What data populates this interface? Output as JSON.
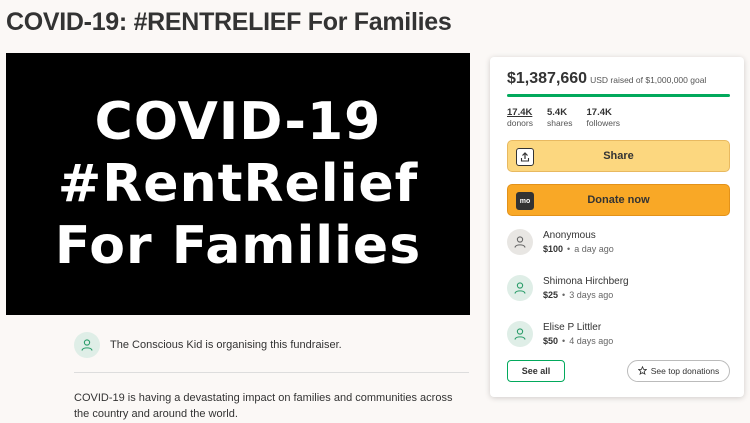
{
  "page": {
    "title": "COVID-19: #RENTRELIEF For Families"
  },
  "hero": {
    "line1": "COVID-19",
    "line2": "#RentRelief",
    "line3": "For Families"
  },
  "organiser": {
    "text": "The Conscious Kid is organising this fundraiser."
  },
  "story": {
    "text": "COVID-19 is having a devastating impact on families and communities across the country and around the world."
  },
  "sidebar": {
    "amount_raised": "$1,387,660",
    "goal_text": "USD raised of $1,000,000 goal",
    "progress_fraction": 1.0,
    "progress_color": "#02a95c",
    "stats": [
      {
        "value": "17.4K",
        "label": "donors"
      },
      {
        "value": "5.4K",
        "label": "shares"
      },
      {
        "value": "17.4K",
        "label": "followers"
      }
    ],
    "share_label": "Share",
    "share_icon": "share-upload-icon",
    "donate_label": "Donate now",
    "donate_icon": "gofundme-icon",
    "donate_icon_text": "mo",
    "donations": [
      {
        "name": "Anonymous",
        "amount": "$100",
        "time": "a day ago"
      },
      {
        "name": "Shimona Hirchberg",
        "amount": "$25",
        "time": "3 days ago"
      },
      {
        "name": "Elise P Littler",
        "amount": "$50",
        "time": "4 days ago"
      }
    ],
    "see_all_label": "See all",
    "see_top_label": "See top donations",
    "star_icon": "star-icon"
  },
  "colors": {
    "accent_green": "#02a95c",
    "share_yellow": "#fcd77f",
    "donate_orange": "#f9a826"
  }
}
